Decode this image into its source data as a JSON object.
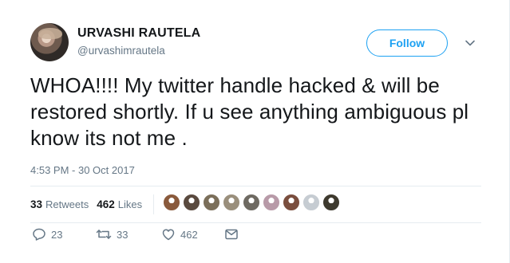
{
  "user": {
    "name": "URVASHI RAUTELA",
    "handle": "@urvashimrautela"
  },
  "follow_label": "Follow",
  "tweet": {
    "text": "WHOA!!!! My twitter handle hacked & will be restored shortly. If u see anything ambiguous pl know its not me .",
    "timestamp": "4:53 PM - 30 Oct 2017"
  },
  "stats": {
    "retweets_count": "33",
    "retweets_label": "Retweets",
    "likes_count": "462",
    "likes_label": "Likes"
  },
  "likers": [
    {
      "icon": "liker-avatar",
      "color": "#8a5a3c"
    },
    {
      "icon": "liker-avatar",
      "color": "#5a4a3f"
    },
    {
      "icon": "liker-avatar",
      "color": "#7b6f5a"
    },
    {
      "icon": "liker-avatar",
      "color": "#9a8f7c"
    },
    {
      "icon": "liker-avatar",
      "color": "#6e6a62"
    },
    {
      "icon": "liker-avatar",
      "color": "#b89aa8"
    },
    {
      "icon": "liker-avatar",
      "color": "#7a4e3e"
    },
    {
      "icon": "liker-avatar",
      "color": "#c6ccd2"
    },
    {
      "icon": "liker-avatar",
      "color": "#3e3a2e"
    }
  ],
  "actions": {
    "replies": "23",
    "retweets": "33",
    "likes": "462"
  },
  "colors": {
    "accent": "#1da1f2",
    "muted": "#657786",
    "text": "#14171a"
  }
}
